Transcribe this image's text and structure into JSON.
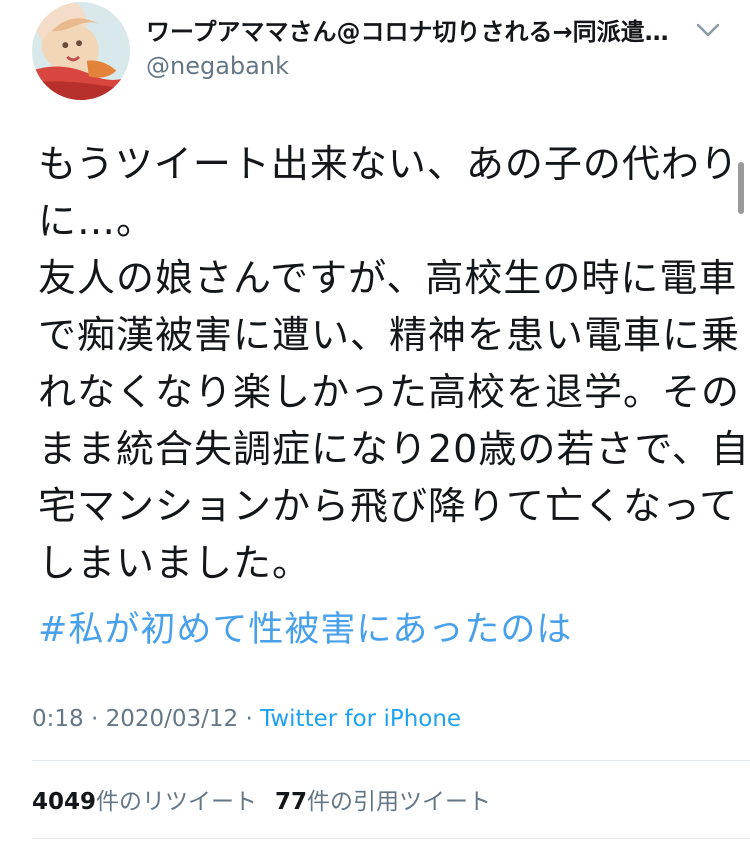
{
  "tweet": {
    "display_name": "ワープアママさん@コロナ切りされる→同派遣…",
    "handle": "@negabank",
    "body_lines": [
      "もうツイート出来ない、あの子の代わり",
      "に…。",
      "友人の娘さんですが、高校生の時に電車",
      "で痴漢被害に遭い、精神を患い電車に乗",
      "れなくなり楽しかった高校を退学。その",
      "まま統合失調症になり20歳の若さで、自",
      "宅マンションから飛び降りて亡くなって",
      "しまいました。"
    ],
    "hashtag": "#私が初めて性被害にあったのは",
    "time": "0:18",
    "date": "2020/03/12",
    "separator": " · ",
    "source": "Twitter for iPhone"
  },
  "stats": {
    "retweet_count": "4049",
    "retweet_label": "件のリツイート",
    "quote_count": "77",
    "quote_label": "件の引用ツイート"
  },
  "icons": {
    "avatar": "avatar-illustration",
    "menu": "chevron-down-icon"
  },
  "colors": {
    "link": "#1da1f2",
    "hashtag": "#4aa1eb",
    "secondary_text": "#657786",
    "primary_text": "#14171a",
    "divider": "#e1e8ed"
  }
}
